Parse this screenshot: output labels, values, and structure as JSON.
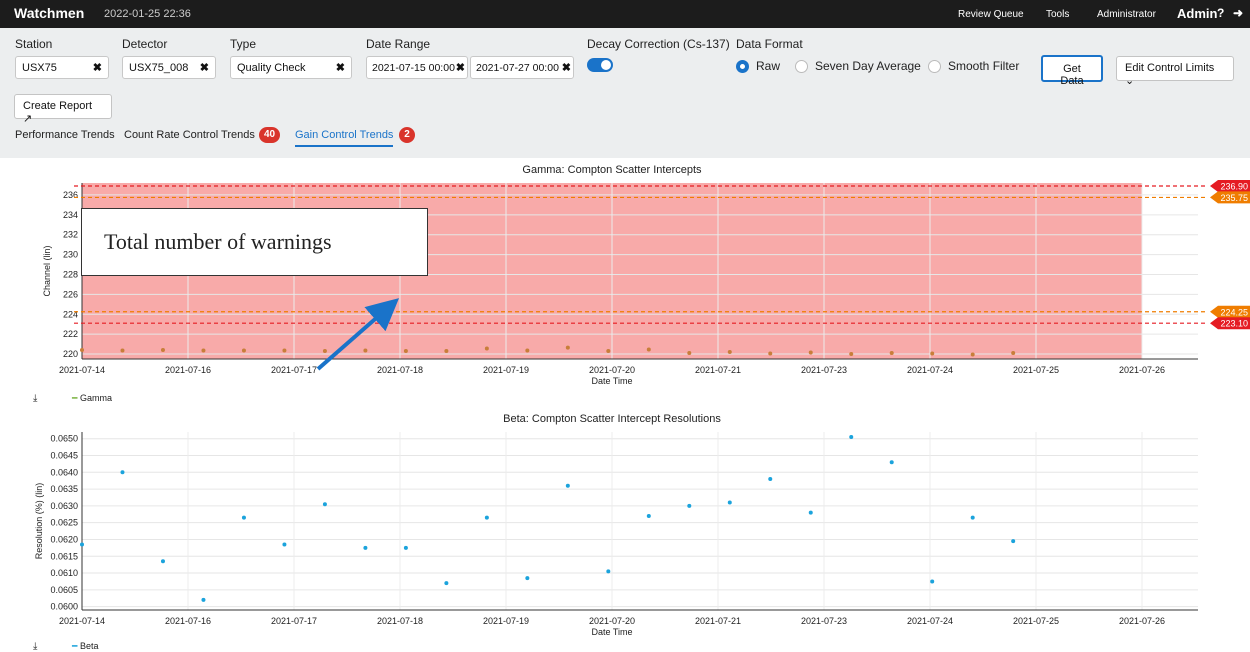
{
  "header": {
    "app_title": "Watchmen",
    "datetime": "2022-01-25 22:36",
    "nav": [
      "Review Queue",
      "Tools",
      "Administrator"
    ],
    "user": "Admin"
  },
  "filters": {
    "station": {
      "label": "Station",
      "value": "USX75"
    },
    "detector": {
      "label": "Detector",
      "value": "USX75_008"
    },
    "type": {
      "label": "Type",
      "value": "Quality Check"
    },
    "date_range": {
      "label": "Date Range",
      "start": "2021-07-15 00:00",
      "end": "2021-07-27 00:00"
    },
    "decay": {
      "label": "Decay Correction (Cs-137)",
      "enabled": true
    },
    "data_format": {
      "label": "Data Format",
      "options": [
        "Raw",
        "Seven Day Average",
        "Smooth Filter"
      ],
      "selected": "Raw"
    },
    "get_data_label": "Get Data",
    "edit_limits_label": "Edit Control Limits",
    "create_report_label": "Create Report"
  },
  "tabs": [
    {
      "label": "Performance Trends"
    },
    {
      "label": "Count Rate Control Trends",
      "badge": "40"
    },
    {
      "label": "Gain Control Trends",
      "badge": "2",
      "active": true
    }
  ],
  "annotation": {
    "text": "Total number of warnings"
  },
  "colors": {
    "accent": "#1a73c9",
    "badge": "#d9342b",
    "warning_band": "#f8aaa9",
    "gamma": "#7cb342",
    "beta": "#1ba3dc",
    "limit_red": "#e51c23",
    "limit_orange": "#ef7d00"
  },
  "chart_data": [
    {
      "type": "scatter",
      "title": "Gamma: Compton Scatter Intercepts",
      "xlabel": "Date Time",
      "ylabel": "Channel (lin)",
      "xlim": [
        "2021-07-14",
        "2021-07-26"
      ],
      "ylim": [
        219.5,
        237.2
      ],
      "yticks": [
        220,
        222,
        224,
        226,
        228,
        230,
        232,
        234,
        236
      ],
      "x_tick_labels": [
        "2021-07-14",
        "2021-07-16",
        "2021-07-17",
        "2021-07-18",
        "2021-07-19",
        "2021-07-20",
        "2021-07-21",
        "2021-07-23",
        "2021-07-24",
        "2021-07-25",
        "2021-07-26"
      ],
      "legend": "Gamma",
      "limits": [
        {
          "value": 236.9,
          "label": "236.90",
          "color": "red"
        },
        {
          "value": 235.75,
          "label": "235.75",
          "color": "orange"
        },
        {
          "value": 224.25,
          "label": "224.25",
          "color": "orange"
        },
        {
          "value": 223.1,
          "label": "223.10",
          "color": "red"
        }
      ],
      "series": [
        {
          "name": "Gamma",
          "points": [
            [
              "2021-07-14",
              220.4
            ],
            [
              "2021-07-14T11",
              220.35
            ],
            [
              "2021-07-14T22",
              220.4
            ],
            [
              "2021-07-15T09",
              220.35
            ],
            [
              "2021-07-15T20",
              220.35
            ],
            [
              "2021-07-16T07",
              220.35
            ],
            [
              "2021-07-16T18",
              220.3
            ],
            [
              "2021-07-17T05",
              220.35
            ],
            [
              "2021-07-17T16",
              220.3
            ],
            [
              "2021-07-18T03",
              220.3
            ],
            [
              "2021-07-18T14",
              220.55
            ],
            [
              "2021-07-19T01",
              220.35
            ],
            [
              "2021-07-19T12",
              220.65
            ],
            [
              "2021-07-19T23",
              220.3
            ],
            [
              "2021-07-20T10",
              220.45
            ],
            [
              "2021-07-20T21",
              220.1
            ],
            [
              "2021-07-21T08",
              220.2
            ],
            [
              "2021-07-21T19",
              220.05
            ],
            [
              "2021-07-22T06",
              220.15
            ],
            [
              "2021-07-22T17",
              220.0
            ],
            [
              "2021-07-23T04",
              220.1
            ],
            [
              "2021-07-23T15",
              220.05
            ],
            [
              "2021-07-24T02",
              219.95
            ],
            [
              "2021-07-24T13",
              220.1
            ]
          ]
        }
      ]
    },
    {
      "type": "scatter",
      "title": "Beta: Compton Scatter Intercept Resolutions",
      "xlabel": "Date Time",
      "ylabel": "Resolution (%) (lin)",
      "xlim": [
        "2021-07-14",
        "2021-07-26"
      ],
      "ylim": [
        0.0599,
        0.0652
      ],
      "yticks": [
        0.06,
        0.0605,
        0.061,
        0.0615,
        0.062,
        0.0625,
        0.063,
        0.0635,
        0.064,
        0.0645,
        0.065
      ],
      "x_tick_labels": [
        "2021-07-14",
        "2021-07-16",
        "2021-07-17",
        "2021-07-18",
        "2021-07-19",
        "2021-07-20",
        "2021-07-21",
        "2021-07-23",
        "2021-07-24",
        "2021-07-25",
        "2021-07-26"
      ],
      "legend": "Beta",
      "series": [
        {
          "name": "Beta",
          "points": [
            [
              "2021-07-14",
              0.06185
            ],
            [
              "2021-07-14T11",
              0.064
            ],
            [
              "2021-07-14T22",
              0.06135
            ],
            [
              "2021-07-15T09",
              0.0602
            ],
            [
              "2021-07-15T20",
              0.06265
            ],
            [
              "2021-07-16T07",
              0.06185
            ],
            [
              "2021-07-16T18",
              0.06305
            ],
            [
              "2021-07-17T05",
              0.06175
            ],
            [
              "2021-07-17T16",
              0.06175
            ],
            [
              "2021-07-18T03",
              0.0607
            ],
            [
              "2021-07-18T14",
              0.06265
            ],
            [
              "2021-07-19T01",
              0.06085
            ],
            [
              "2021-07-19T12",
              0.0636
            ],
            [
              "2021-07-19T23",
              0.06105
            ],
            [
              "2021-07-20T10",
              0.0627
            ],
            [
              "2021-07-20T21",
              0.063
            ],
            [
              "2021-07-21T08",
              0.0631
            ],
            [
              "2021-07-21T19",
              0.0638
            ],
            [
              "2021-07-22T06",
              0.0628
            ],
            [
              "2021-07-22T17",
              0.06505
            ],
            [
              "2021-07-23T04",
              0.0643
            ],
            [
              "2021-07-23T15",
              0.06075
            ],
            [
              "2021-07-24T02",
              0.06265
            ],
            [
              "2021-07-24T13",
              0.06195
            ]
          ]
        }
      ]
    }
  ]
}
